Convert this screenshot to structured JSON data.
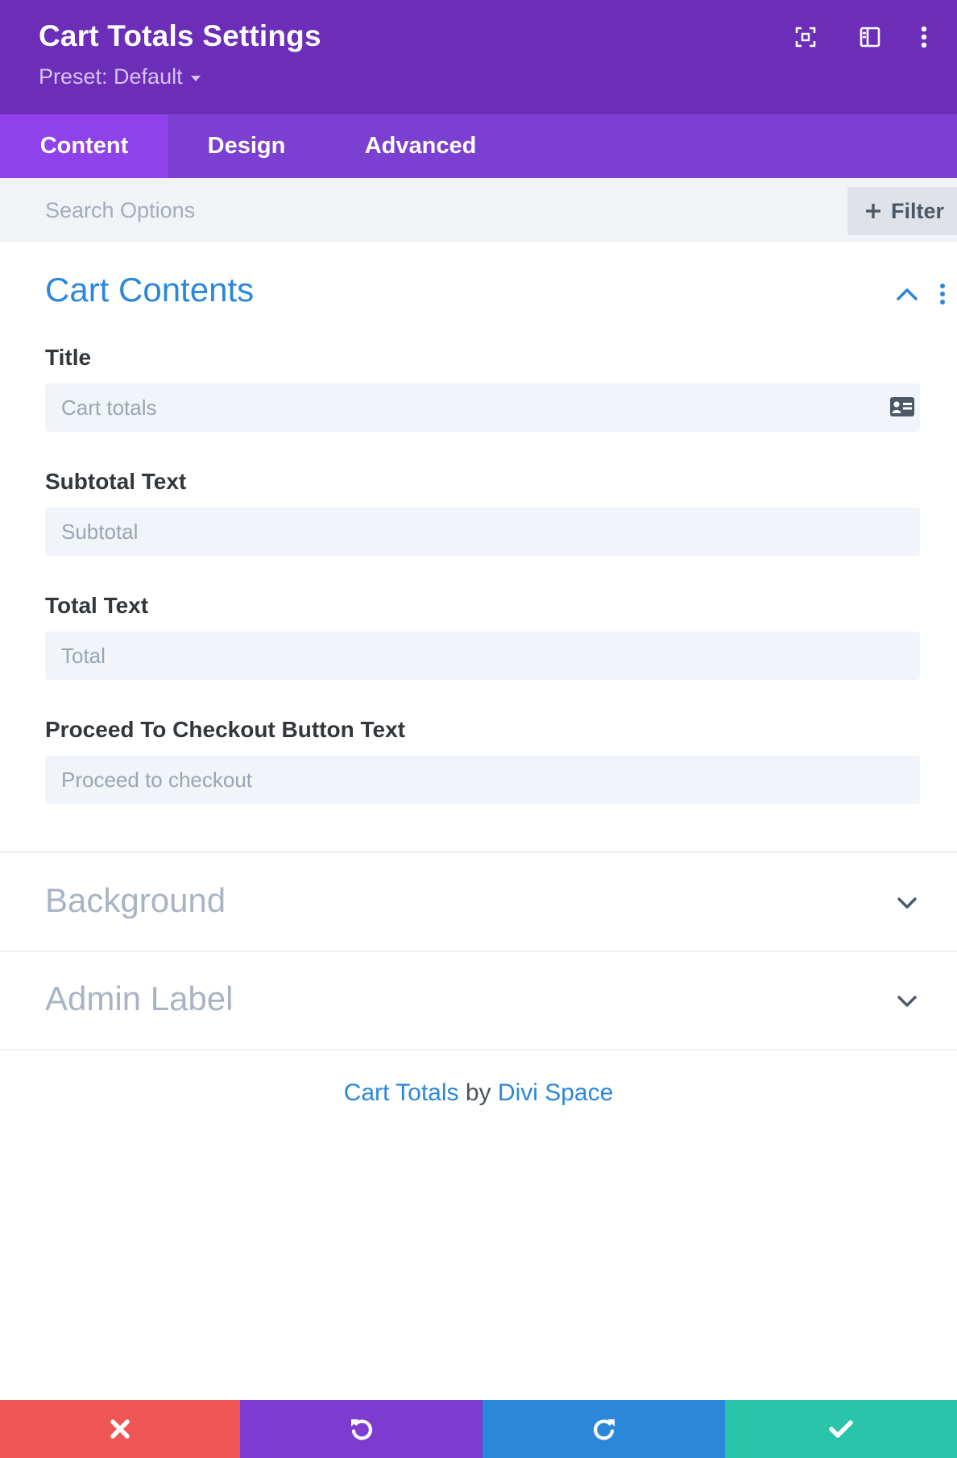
{
  "header": {
    "title": "Cart Totals Settings",
    "preset": "Preset: Default",
    "icons": [
      "expand-icon",
      "sidebar-layout-icon",
      "more-vertical-icon"
    ]
  },
  "tabs": [
    {
      "label": "Content",
      "active": true
    },
    {
      "label": "Design",
      "active": false
    },
    {
      "label": "Advanced",
      "active": false
    }
  ],
  "search": {
    "placeholder": "Search Options",
    "filter_label": "Filter"
  },
  "sections": {
    "cart_contents": {
      "title": "Cart Contents",
      "fields": [
        {
          "label": "Title",
          "placeholder": "Cart totals",
          "icon": "dynamic-content-icon"
        },
        {
          "label": "Subtotal Text",
          "placeholder": "Subtotal"
        },
        {
          "label": "Total Text",
          "placeholder": "Total"
        },
        {
          "label": "Proceed To Checkout Button Text",
          "placeholder": "Proceed to checkout"
        }
      ]
    },
    "background": {
      "title": "Background"
    },
    "admin_label": {
      "title": "Admin Label"
    }
  },
  "credit": {
    "module": "Cart Totals",
    "by": "by",
    "author": "Divi Space"
  },
  "bottom_bar": [
    {
      "action": "discard",
      "icon": "close-icon",
      "color": "#ef5555"
    },
    {
      "action": "undo",
      "icon": "undo-icon",
      "color": "#7e3bd0"
    },
    {
      "action": "redo",
      "icon": "redo-icon",
      "color": "#2b87da"
    },
    {
      "action": "save",
      "icon": "check-icon",
      "color": "#29c4a9"
    }
  ],
  "colors": {
    "header_bg": "#6c2eb9",
    "tabs_bg": "#7b3fd1",
    "tab_active_bg": "#8f42ec",
    "accent_blue": "#2b87da"
  }
}
